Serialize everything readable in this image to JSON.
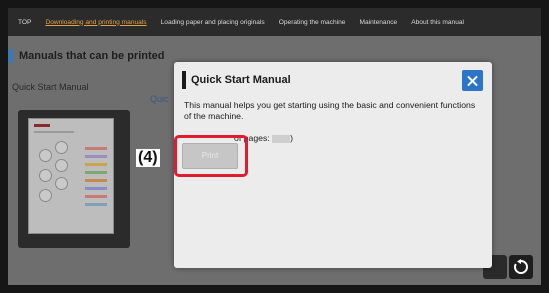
{
  "nav": {
    "items": [
      "TOP",
      "Downloading and printing manuals",
      "Loading paper and placing originals",
      "Operating the machine",
      "Maintenance",
      "About this manual"
    ],
    "active_index": 1
  },
  "screen": {
    "section_title": "Manuals that can be printed",
    "manual_label": "Quick Start Manual",
    "clipped_label": "Quic"
  },
  "modal": {
    "title": "Quick Start Manual",
    "description": "This manual helps you get starting using the basic and convenient functions of the machine.",
    "pages_text": "of pages:",
    "pages_suffix": ")",
    "print_label": "Print"
  },
  "annotation": {
    "step_label": "(4)",
    "highlight_color": "#e11b30"
  },
  "colors": {
    "accent_blue": "#2b74c8",
    "nav_active": "#e0a243",
    "section_marker": "#3b78b8"
  },
  "icons": [
    "close-icon",
    "home-icon",
    "refresh-icon"
  ]
}
